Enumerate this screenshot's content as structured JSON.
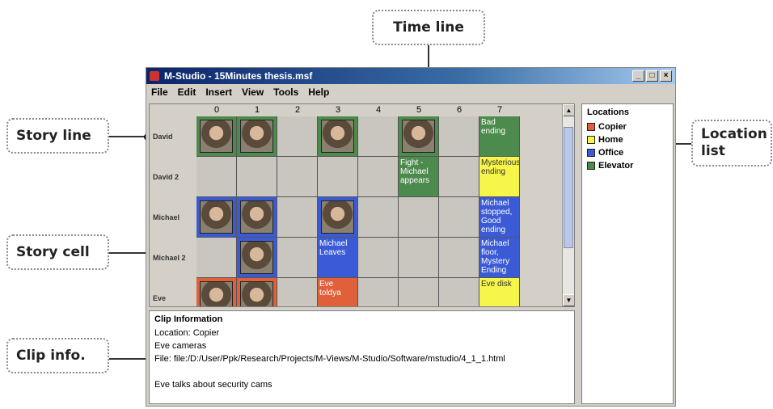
{
  "callouts": {
    "timeline": "Time line",
    "storyline": "Story line",
    "location_list": "Location list",
    "storycell": "Story cell",
    "clipinfo": "Clip info."
  },
  "window": {
    "title": "M-Studio - 15Minutes thesis.msf",
    "buttons": [
      "_",
      "□",
      "×"
    ]
  },
  "menu": [
    "File",
    "Edit",
    "Insert",
    "View",
    "Tools",
    "Help"
  ],
  "grid": {
    "columns": [
      "0",
      "1",
      "2",
      "3",
      "4",
      "5",
      "6",
      "7"
    ],
    "rows": [
      {
        "name": "David",
        "cells": [
          {
            "color": "green",
            "thumb": true
          },
          {
            "color": "green",
            "thumb": true
          },
          {
            "color": "empty"
          },
          {
            "color": "green",
            "thumb": true
          },
          {
            "color": "empty"
          },
          {
            "color": "green",
            "thumb": true
          },
          {
            "color": "empty"
          },
          {
            "color": "green",
            "text": "Bad ending"
          }
        ]
      },
      {
        "name": "David 2",
        "cells": [
          {
            "color": "empty"
          },
          {
            "color": "empty"
          },
          {
            "color": "empty"
          },
          {
            "color": "empty"
          },
          {
            "color": "empty"
          },
          {
            "color": "green",
            "text": "Fight - Michael appears"
          },
          {
            "color": "empty"
          },
          {
            "color": "yellow",
            "text": "Mysterious ending"
          }
        ]
      },
      {
        "name": "Michael",
        "cells": [
          {
            "color": "blue",
            "thumb": true
          },
          {
            "color": "blue",
            "thumb": true
          },
          {
            "color": "empty"
          },
          {
            "color": "blue",
            "thumb": true
          },
          {
            "color": "empty"
          },
          {
            "color": "empty"
          },
          {
            "color": "empty"
          },
          {
            "color": "blue",
            "text": "Michael stopped, Good ending"
          }
        ]
      },
      {
        "name": "Michael 2",
        "cells": [
          {
            "color": "empty"
          },
          {
            "color": "blue",
            "thumb": true
          },
          {
            "color": "empty"
          },
          {
            "color": "blue",
            "text": "Michael Leaves"
          },
          {
            "color": "empty"
          },
          {
            "color": "empty"
          },
          {
            "color": "empty"
          },
          {
            "color": "blue",
            "text": "Michael floor, Mystery Ending"
          }
        ]
      },
      {
        "name": "Eve",
        "cells": [
          {
            "color": "orange",
            "thumb": true
          },
          {
            "color": "orange",
            "thumb": true
          },
          {
            "color": "empty"
          },
          {
            "color": "orange",
            "text": "Eve toldya"
          },
          {
            "color": "empty"
          },
          {
            "color": "empty"
          },
          {
            "color": "empty"
          },
          {
            "color": "yellow",
            "text": "Eve disk"
          }
        ]
      }
    ]
  },
  "locations": {
    "title": "Locations",
    "items": [
      {
        "label": "Copier",
        "color": "#e0603a"
      },
      {
        "label": "Home",
        "color": "#f5f54a"
      },
      {
        "label": "Office",
        "color": "#3b5bd6"
      },
      {
        "label": "Elevator",
        "color": "#4d8a4d"
      }
    ]
  },
  "clip": {
    "title": "Clip Information",
    "location": "Location: Copier",
    "name": "Eve cameras",
    "file": "File: file:/D:/User/Ppk/Research/Projects/M-Views/M-Studio/Software/mstudio/4_1_1.html",
    "blank": "",
    "description": "Eve talks about security cams"
  },
  "colors": {
    "green": "#4d8a4d",
    "blue": "#3b5bd6",
    "yellow": "#f5f54a",
    "orange": "#e0603a",
    "empty": "#c9c6bf"
  }
}
